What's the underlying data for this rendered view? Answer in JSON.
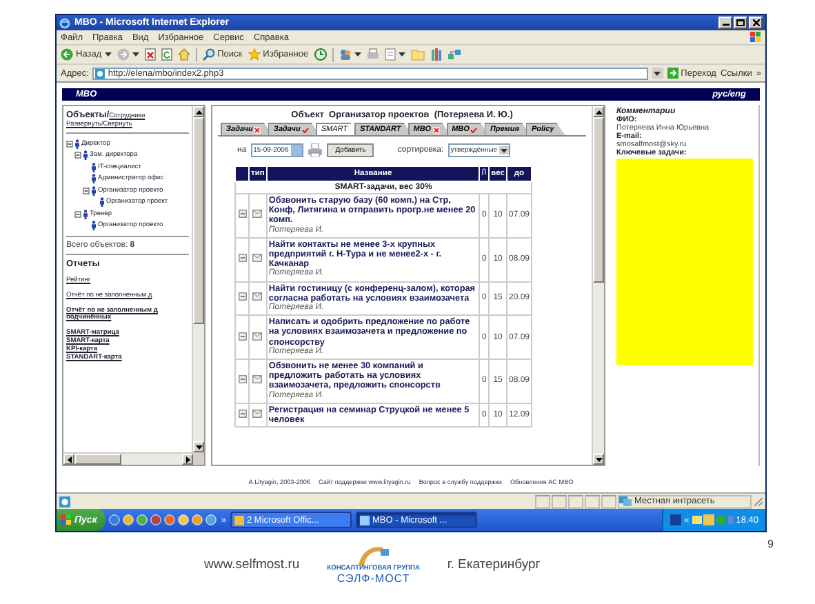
{
  "window": {
    "title": "MBO - Microsoft Internet Explorer"
  },
  "menu": [
    "Файл",
    "Правка",
    "Вид",
    "Избранное",
    "Сервис",
    "Справка"
  ],
  "toolbar": {
    "back": "Назад",
    "search": "Поиск",
    "favorites": "Избранное"
  },
  "address_bar": {
    "label": "Адрес:",
    "url": "http://elena/mbo/index2.php3",
    "go": "Переход",
    "links": "Ссылки",
    "more": "»"
  },
  "site_header": {
    "title": "MBO",
    "language": "рус/eng"
  },
  "left_panel": {
    "heading": "Объекты/",
    "heading_link": "Сотрудники",
    "expand": "Развернуть",
    "separator": "/",
    "collapse": "Свернуть",
    "tree": [
      {
        "label": "Директор",
        "expanded": true,
        "children": [
          {
            "label": "Зам. директора",
            "expanded": true,
            "children": [
              {
                "label": "IT-специалист"
              },
              {
                "label": "Администратор офис"
              },
              {
                "label": "Организатор проекто",
                "expanded": true,
                "children": [
                  {
                    "label": "Организатор проект"
                  }
                ]
              }
            ]
          },
          {
            "label": "Тренер",
            "expanded": true,
            "children": [
              {
                "label": "Организатор проекто"
              }
            ]
          }
        ]
      }
    ],
    "total_label": "Всего объектов:",
    "total": "8",
    "reports_title": "Отчеты",
    "reports": [
      {
        "lines": [
          "Рейтинг"
        ],
        "bold": false
      },
      {
        "lines": [
          "Отчёт по не заполненным д"
        ],
        "bold": false
      },
      {
        "lines": [
          "Отчёт по не заполненным д",
          "подчинённых"
        ],
        "bold": true
      },
      {
        "lines": [
          "SMART-матрица"
        ],
        "bold": true
      },
      {
        "lines": [
          "SMART-карта"
        ],
        "bold": true
      },
      {
        "lines": [
          "KPI-карта"
        ],
        "bold": true
      },
      {
        "lines": [
          "STANDART-карта"
        ],
        "bold": true
      }
    ]
  },
  "main": {
    "object_label": "Объект",
    "object_value": "Организатор проектов  (Потеряева И. Ю.)",
    "tabs": [
      {
        "label": "Задачи",
        "kind": "cross",
        "selected": false
      },
      {
        "label": "Задачи",
        "kind": "tick",
        "selected": false
      },
      {
        "label": "SMART",
        "kind": "plain",
        "selected": true
      },
      {
        "label": "STANDART",
        "kind": "plain",
        "selected": false
      },
      {
        "label": "MBO",
        "kind": "cross",
        "selected": false
      },
      {
        "label": "MBO",
        "kind": "tick",
        "selected": false
      },
      {
        "label": "Премия",
        "kind": "plain",
        "selected": false
      },
      {
        "label": "Policy",
        "kind": "plain",
        "selected": false
      }
    ],
    "date_label": "на",
    "date": "15-09-2006",
    "add_button": "Добавить",
    "sort_label": "сортировка:",
    "sort_value": "утверждённые",
    "columns": [
      "тип",
      "Название",
      "вес",
      "до"
    ],
    "group": "SMART-задачи, вес 30%",
    "rows": [
      {
        "title": "Обзвонить старую базу (60 комп.) на Стр, Конф, Литягина и отправить прогр.не менее 20 комп.",
        "author": "Потеряева И.",
        "count": "0",
        "weight": "10",
        "due": "07.09"
      },
      {
        "title": "Найти контакты не менее 3-х крупных предприятий г. Н-Тура и не менее2-х - г. Качканар",
        "author": "Потеряева И.",
        "count": "0",
        "weight": "10",
        "due": "08.09"
      },
      {
        "title": "Найти гостиницу (с конференц-залом), которая согласна работать на условиях взаимозачета",
        "author": "Потеряева И.",
        "count": "0",
        "weight": "15",
        "due": "20.09"
      },
      {
        "title": "Написать и одобрить предложение по работе на условиях взаимозачета и предложение по спонсорству",
        "author": "Потеряева И.",
        "count": "0",
        "weight": "10",
        "due": "07.09"
      },
      {
        "title": "Обзвонить не менее 30 компаний и предложить работать на условиях взаимозачета, предложить спонсорств",
        "author": "Потеряева И.",
        "count": "0",
        "weight": "15",
        "due": "08.09"
      },
      {
        "title": "Регистрация на семинар Струцкой не менее 5 человек",
        "count": "0",
        "weight": "10",
        "due": "12.09"
      }
    ]
  },
  "right_panel": {
    "title": "Комментарии",
    "name_label": "ФИО:",
    "name": "Потеряева Инна Юрьевна",
    "email_label": "E-mail:",
    "email": "smosalfmost@sky.ru",
    "tasks_label": "Ключевые задачи:"
  },
  "page_footer": [
    "A.Lityagin, 2003-2006",
    "Сайт поддержки www.lityagin.ru",
    "Вопрос в службу поддержки",
    "Обновления АС MBO"
  ],
  "status_bar": {
    "zone": "Местная интрасеть"
  },
  "taskbar": {
    "start": "Пуск",
    "more": "»",
    "tasks": [
      {
        "label": "2 Microsoft Offic...",
        "selected": false
      },
      {
        "label": "MBO - Microsoft ...",
        "selected": true
      }
    ],
    "tray_more": "«",
    "clock": "18:40"
  },
  "slide_footer": {
    "site": "www.selfmost.ru",
    "logo_line1": "КОНСАЛТИНГОВАЯ ГРУППА",
    "logo_line2": "СЭЛФ-МОСТ",
    "city": "г. Екатеринбург",
    "page": "9"
  }
}
